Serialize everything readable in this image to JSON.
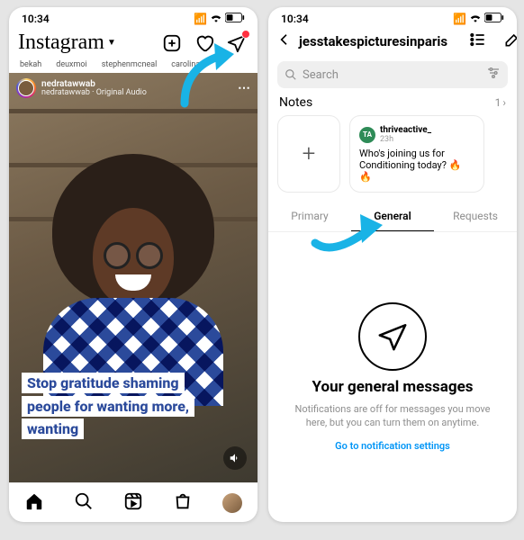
{
  "status": {
    "time": "10:34"
  },
  "feed": {
    "brand": "Instagram",
    "stories": [
      "bekah",
      "deuxmoi",
      "stephenmcneal",
      "carolinag"
    ],
    "post": {
      "user": "nedratawwab",
      "audio": "nedratawwab · Original Audio",
      "caption": "Stop gratitude shaming people for wanting more, wanting"
    },
    "dm_badge": "1"
  },
  "dm": {
    "username": "jesstakespicturesinparis",
    "search_placeholder": "Search",
    "notes_label": "Notes",
    "notes_count": "1",
    "note": {
      "avatar_initials": "TA",
      "author": "thriveactive_",
      "time": "23h",
      "text": "Who's joining us for Conditioning today? 🔥 🔥"
    },
    "tabs": {
      "primary": "Primary",
      "general": "General",
      "requests": "Requests",
      "active": "general"
    },
    "empty": {
      "title": "Your general messages",
      "subtitle": "Notifications are off for messages you move here, but you can turn them on anytime.",
      "link": "Go to notification settings"
    }
  }
}
